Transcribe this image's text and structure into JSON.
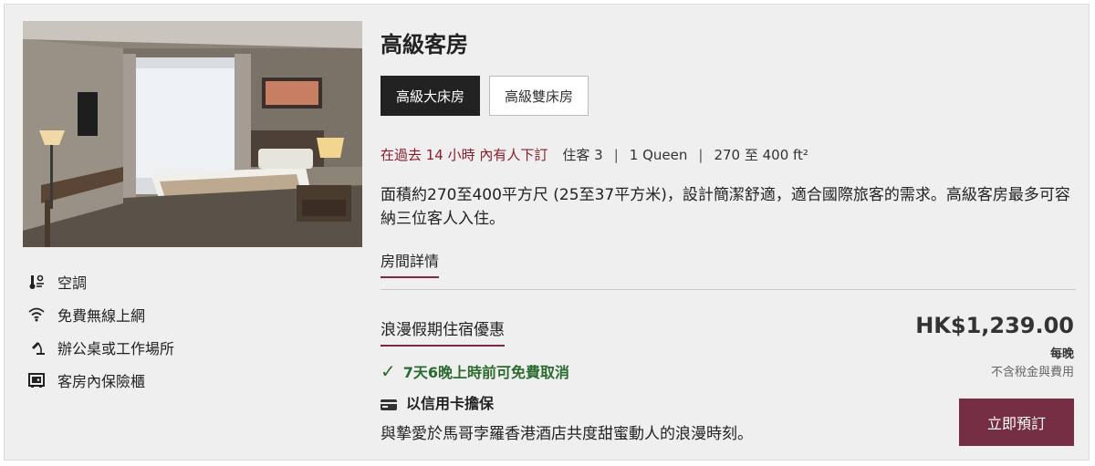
{
  "room": {
    "title": "高級客房",
    "tabs": [
      {
        "label": "高級大床房",
        "active": true
      },
      {
        "label": "高級雙床房",
        "active": false
      }
    ],
    "urgency": "在過去 14 小時 內有人下訂",
    "guests": "住客 3",
    "bed": "1 Queen",
    "size": "270 至 400 ft²",
    "description": "面積約270至400平方尺 (25至37平方米)，設計簡潔舒適，適合國際旅客的需求。高級客房最多可容納三位客人入住。",
    "details_link": "房間詳情"
  },
  "amenities": [
    {
      "icon": "air-conditioning-icon",
      "label": "空調"
    },
    {
      "icon": "wifi-icon",
      "label": "免費無線上網"
    },
    {
      "icon": "desk-lamp-icon",
      "label": "辦公桌或工作場所"
    },
    {
      "icon": "safe-icon",
      "label": "客房內保險櫃"
    }
  ],
  "offer": {
    "name": "浪漫假期住宿優惠",
    "cancellation": "7天6晚上時前可免費取消",
    "guarantee": "以信用卡擔保",
    "promo_text": "與摯愛於馬哥孛羅香港酒店共度甜蜜動人的浪漫時刻。",
    "price": "HK$1,239.00",
    "per_night": "每晚",
    "tax_note": "不含稅金與費用",
    "book_label": "立即預訂"
  },
  "colors": {
    "accent": "#742d43",
    "urgent": "#8b1c2c",
    "success": "#2c6b2f"
  }
}
